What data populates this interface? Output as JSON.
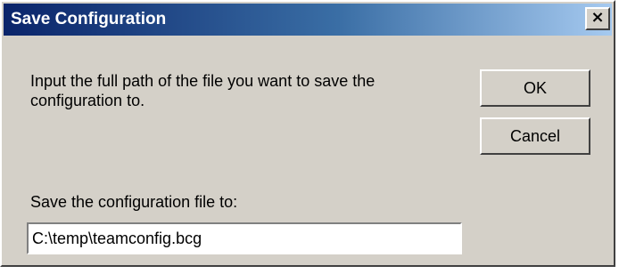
{
  "window": {
    "title": "Save Configuration",
    "close_glyph": "×",
    "colors": {
      "titlebar_start": "#0a246a",
      "titlebar_end": "#a6caf0",
      "face": "#d4d0c8"
    }
  },
  "content": {
    "instruction": "Input the full path of the file you want to save the configuration to.",
    "field_label": "Save the configuration file to:",
    "path_value": "C:\\temp\\teamconfig.bcg"
  },
  "buttons": {
    "ok_label": "OK",
    "cancel_label": "Cancel"
  }
}
